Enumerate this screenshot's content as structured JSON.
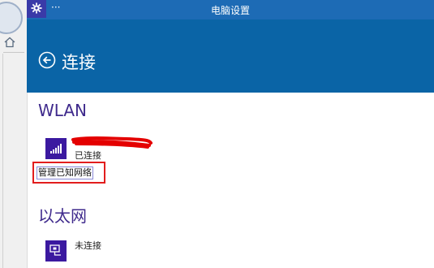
{
  "titlebar": {
    "dots": "···",
    "title": "电脑设置"
  },
  "header": {
    "title": "连接"
  },
  "wlan": {
    "section_title": "WLAN",
    "network_status": "已连接",
    "manage_link": "管理已知网络"
  },
  "ethernet": {
    "section_title": "以太网",
    "network_status": "未连接"
  },
  "colors": {
    "titlebar": "#1d6bb5",
    "header": "#0a64a6",
    "tile": "#3b19a0",
    "section_title": "#3f2a8c",
    "highlight": "#e21d1d",
    "redaction": "#e40000"
  },
  "icons": {
    "app": "gear-icon",
    "back": "back-arrow-icon",
    "wifi": "wifi-signal-icon",
    "ethernet": "ethernet-icon",
    "home": "home-icon"
  }
}
